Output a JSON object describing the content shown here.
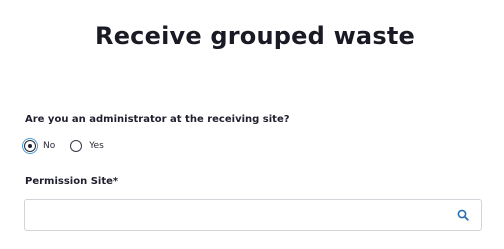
{
  "page": {
    "title": "Receive grouped waste"
  },
  "admin_question": {
    "label": "Are you an administrator at the receiving site?",
    "options": [
      {
        "label": "No",
        "selected": true
      },
      {
        "label": "Yes",
        "selected": false
      }
    ]
  },
  "permission_site": {
    "label": "Permission Site*",
    "value": "",
    "placeholder": "",
    "icon": "search-icon"
  },
  "colors": {
    "focus_ring": "#4f9fd6",
    "search_icon": "#2b6fb3",
    "border": "#d2d4d9"
  }
}
